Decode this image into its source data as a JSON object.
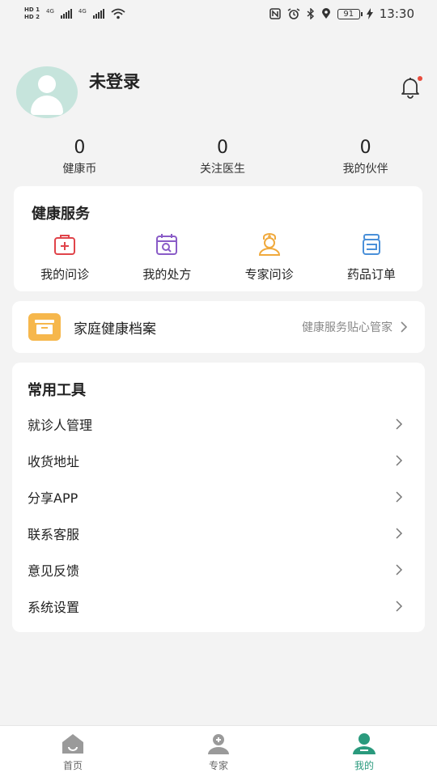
{
  "status_bar": {
    "sim1": "HD 1",
    "sim2": "HD 2",
    "net1": "4G",
    "net2": "4G",
    "battery": "91",
    "time": "13:30"
  },
  "profile": {
    "username": "未登录",
    "avatar_icon": "user-avatar-icon",
    "bell_icon": "bell-icon"
  },
  "stats": [
    {
      "value": "0",
      "label": "健康币"
    },
    {
      "value": "0",
      "label": "关注医生"
    },
    {
      "value": "0",
      "label": "我的伙伴"
    }
  ],
  "services": {
    "title": "健康服务",
    "items": [
      {
        "label": "我的问诊",
        "icon": "medical-kit-icon",
        "color": "#e0444a"
      },
      {
        "label": "我的处方",
        "icon": "calendar-search-icon",
        "color": "#8a5cc7"
      },
      {
        "label": "专家问诊",
        "icon": "doctor-icon",
        "color": "#f0a93c"
      },
      {
        "label": "药品订单",
        "icon": "medicine-bottle-icon",
        "color": "#4a90d9"
      }
    ]
  },
  "archive": {
    "title": "家庭健康档案",
    "subtitle": "健康服务贴心管家",
    "icon": "archive-box-icon",
    "color": "#f6b74c"
  },
  "tools": {
    "title": "常用工具",
    "items": [
      {
        "label": "就诊人管理"
      },
      {
        "label": "收货地址"
      },
      {
        "label": "分享APP"
      },
      {
        "label": "联系客服"
      },
      {
        "label": "意见反馈"
      },
      {
        "label": "系统设置"
      }
    ]
  },
  "tabbar": {
    "items": [
      {
        "label": "首页",
        "icon": "home-icon",
        "active": false
      },
      {
        "label": "专家",
        "icon": "doctor-tab-icon",
        "active": false
      },
      {
        "label": "我的",
        "icon": "profile-tab-icon",
        "active": true
      }
    ],
    "active_color": "#2a9a7d",
    "inactive_color": "#9a9a9a"
  }
}
